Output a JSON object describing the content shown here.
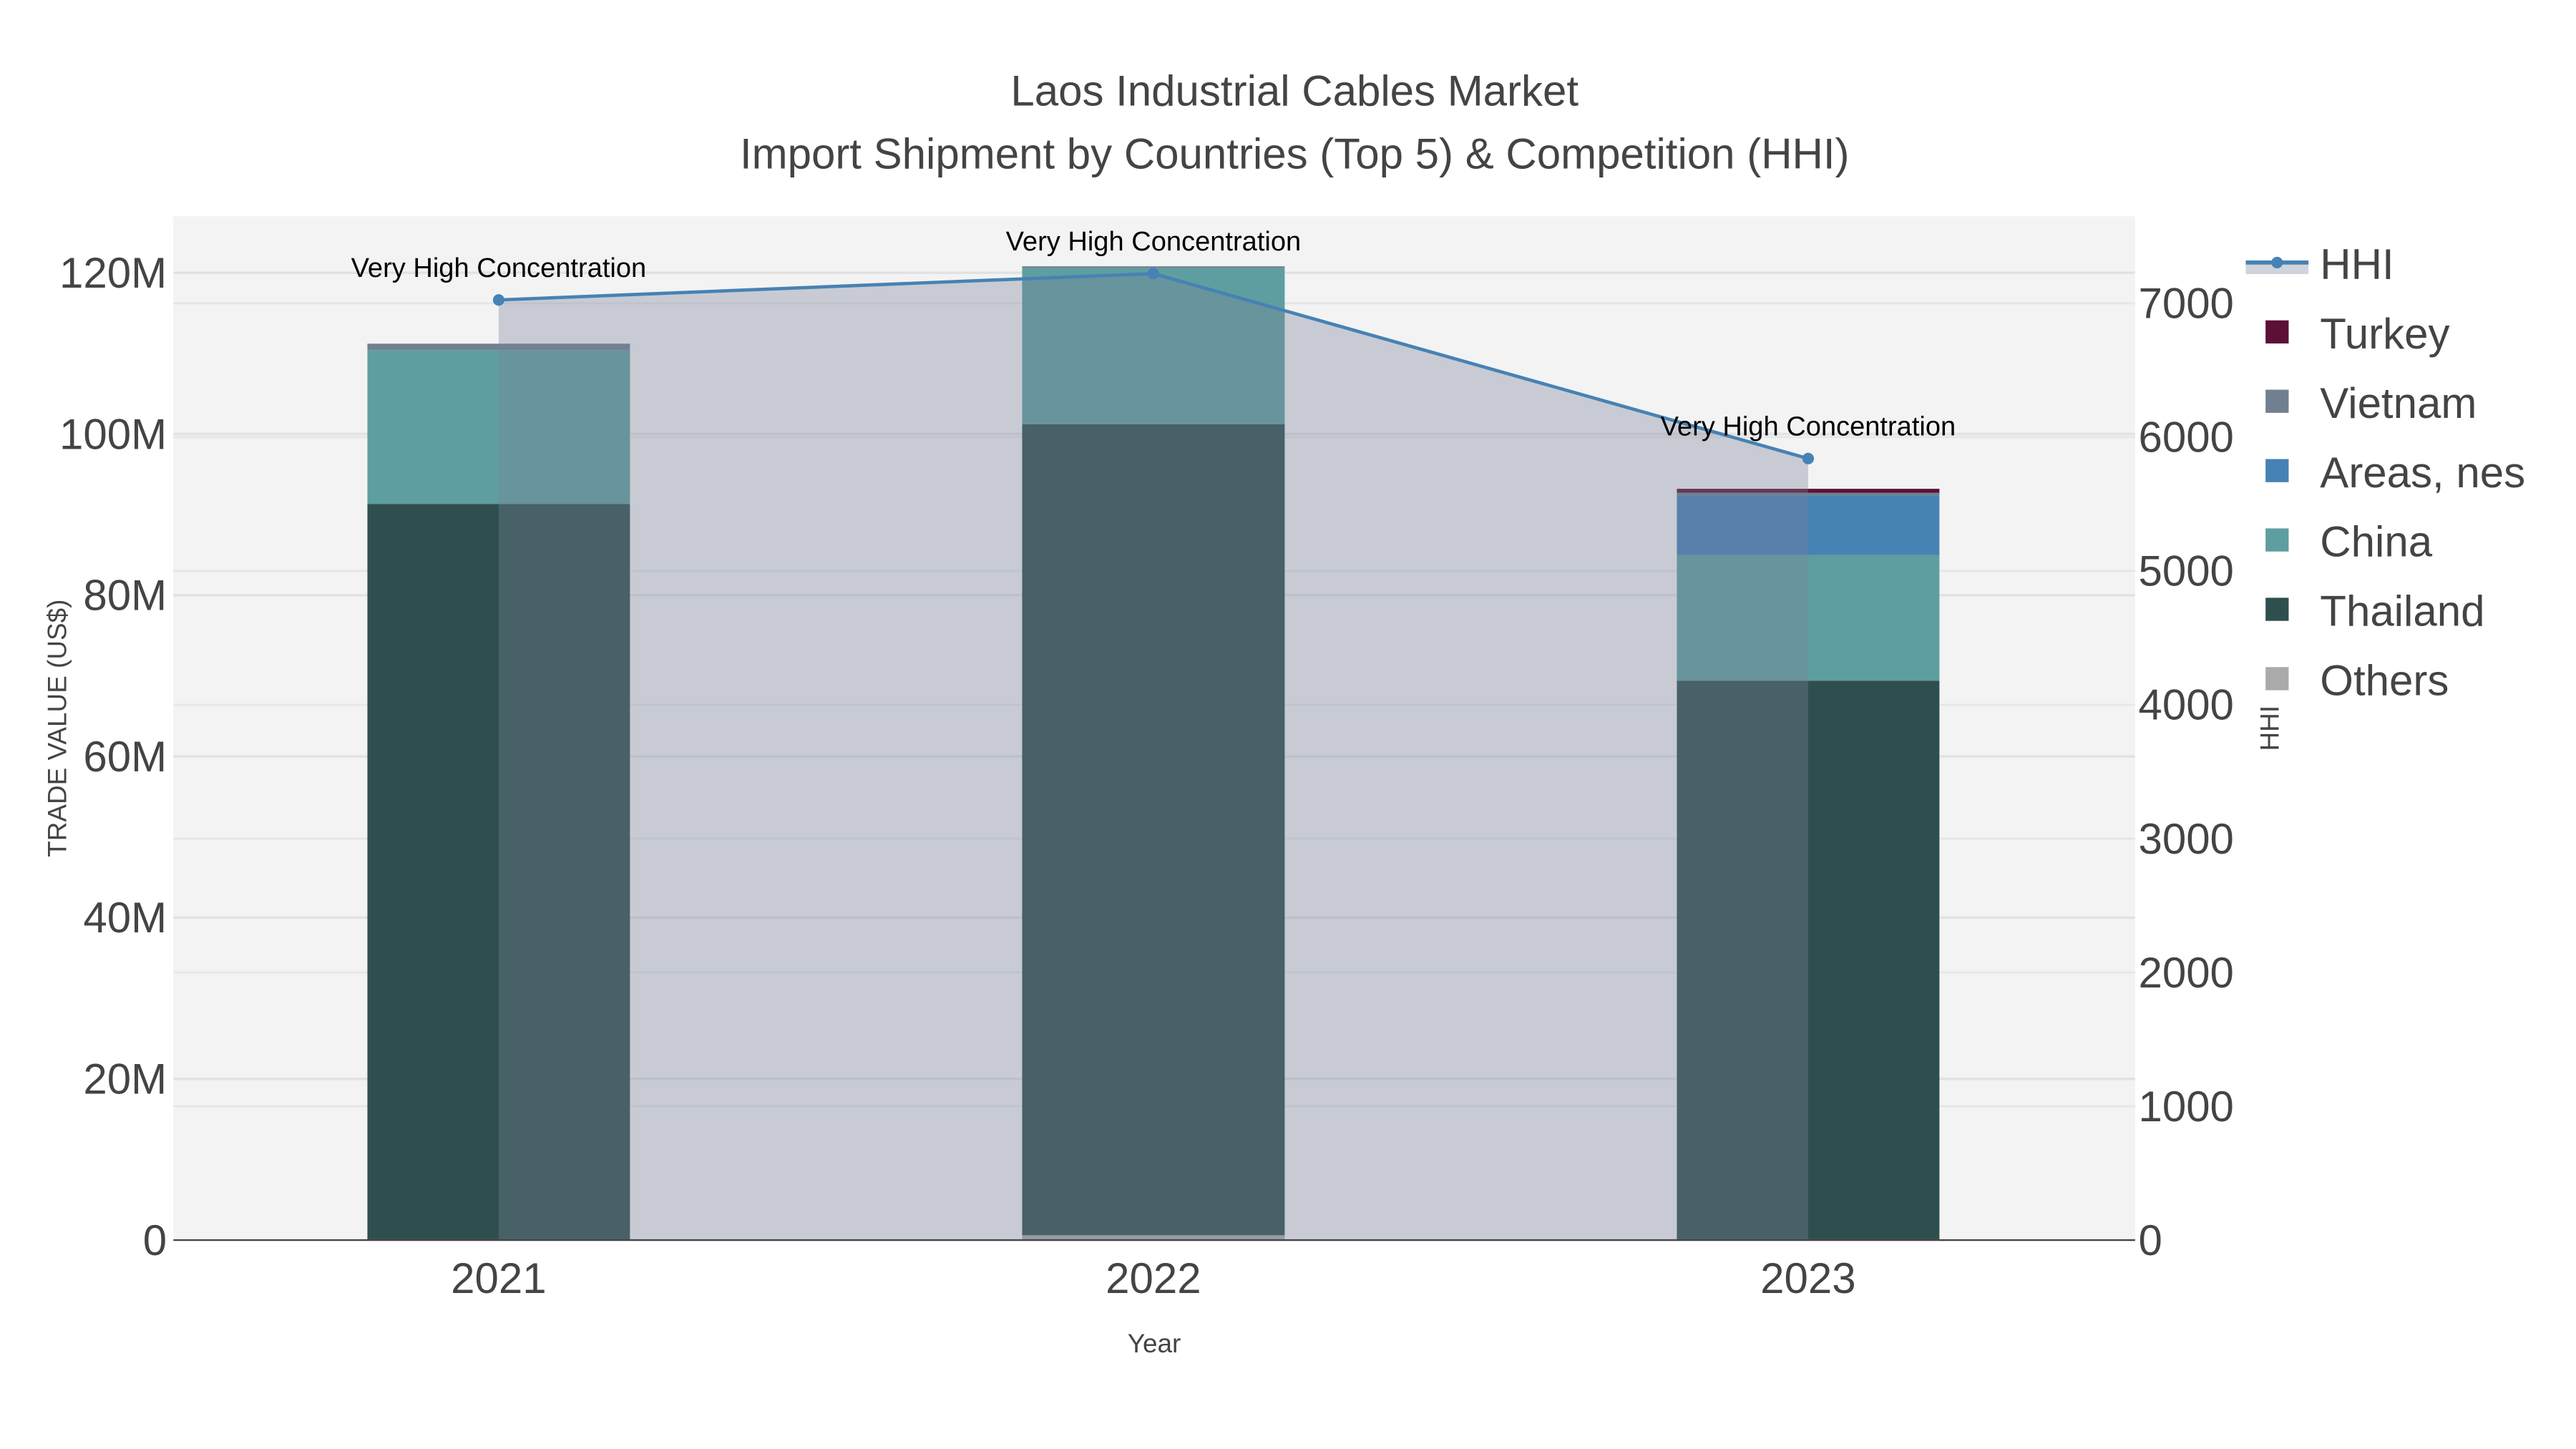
{
  "chart_data": {
    "type": "bar",
    "title": "Laos Industrial Cables Market",
    "subtitle": "Import Shipment by Countries (Top 5) & Competition (HHI)",
    "xlabel": "Year",
    "ylabel": "TRADE VALUE (US$)",
    "y2label": "HHI",
    "categories": [
      "2021",
      "2022",
      "2023"
    ],
    "ylim": [
      0,
      127000000
    ],
    "y2lim": [
      0,
      7650
    ],
    "yticks": [
      {
        "v": 0,
        "label": "0"
      },
      {
        "v": 20000000,
        "label": "20M"
      },
      {
        "v": 40000000,
        "label": "40M"
      },
      {
        "v": 60000000,
        "label": "60M"
      },
      {
        "v": 80000000,
        "label": "80M"
      },
      {
        "v": 100000000,
        "label": "100M"
      },
      {
        "v": 120000000,
        "label": "120M"
      }
    ],
    "y2ticks": [
      {
        "v": 0,
        "label": "0"
      },
      {
        "v": 1000,
        "label": "1000"
      },
      {
        "v": 2000,
        "label": "2000"
      },
      {
        "v": 3000,
        "label": "3000"
      },
      {
        "v": 4000,
        "label": "4000"
      },
      {
        "v": 5000,
        "label": "5000"
      },
      {
        "v": 6000,
        "label": "6000"
      },
      {
        "v": 7000,
        "label": "7000"
      }
    ],
    "series": [
      {
        "name": "Others",
        "color": "#aaaaaa",
        "values": [
          100000,
          600000,
          100000
        ]
      },
      {
        "name": "Thailand",
        "color": "#2f4f4f",
        "values": [
          91200000,
          100600000,
          69300000
        ]
      },
      {
        "name": "China",
        "color": "#5f9ea0",
        "values": [
          19100000,
          19400000,
          15600000
        ]
      },
      {
        "name": "Areas, nes",
        "color": "#4682b4",
        "values": [
          0,
          0,
          7400000
        ]
      },
      {
        "name": "Vietnam",
        "color": "#708090",
        "values": [
          800000,
          200000,
          300000
        ]
      },
      {
        "name": "Turkey",
        "color": "#5c1035",
        "values": [
          0,
          0,
          500000
        ]
      }
    ],
    "hhi": {
      "name": "HHI",
      "color": "#4682b4",
      "values": [
        7025,
        7222,
        5840
      ],
      "annotations": [
        "Very High Concentration",
        "Very High Concentration",
        "Very High Concentration"
      ]
    },
    "legend": [
      "HHI",
      "Turkey",
      "Vietnam",
      "Areas, nes",
      "China",
      "Thailand",
      "Others"
    ],
    "legend_placement": "right",
    "grid": true
  }
}
